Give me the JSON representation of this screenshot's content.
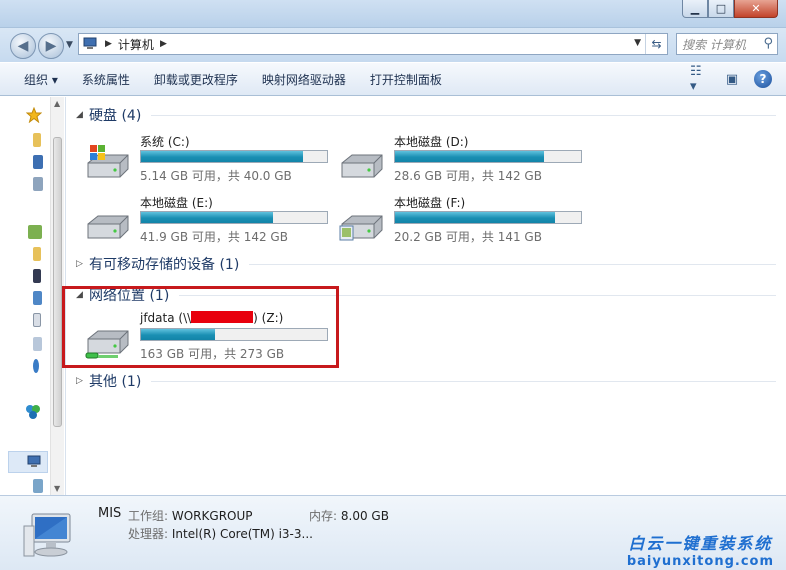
{
  "window": {
    "controls": {
      "minimize": "▁",
      "maximize": "□",
      "close": "✕"
    }
  },
  "address_bar": {
    "crumbs": [
      "计算机"
    ],
    "search_placeholder": "搜索 计算机"
  },
  "toolbar": {
    "organize": "组织 ▾",
    "system_properties": "系统属性",
    "uninstall": "卸载或更改程序",
    "map_drive": "映射网络驱动器",
    "control_panel": "打开控制面板"
  },
  "groups": {
    "hard_disks": "硬盘 (4)",
    "removable": "有可移动存储的设备 (1)",
    "network": "网络位置 (1)",
    "other": "其他 (1)"
  },
  "drives": [
    {
      "name": "系统 (C:)",
      "free": "5.14 GB 可用，共 40.0 GB",
      "used_fraction": 0.87
    },
    {
      "name": "本地磁盘 (D:)",
      "free": "28.6 GB 可用，共 142 GB",
      "used_fraction": 0.8
    },
    {
      "name": "本地磁盘 (E:)",
      "free": "41.9 GB 可用，共 142 GB",
      "used_fraction": 0.71
    },
    {
      "name": "本地磁盘 (F:)",
      "free": "20.2 GB 可用，共 141 GB",
      "used_fraction": 0.86
    }
  ],
  "network_drive": {
    "name_prefix": "jfdata (\\\\",
    "name_suffix": ") (Z:)",
    "free": "163 GB 可用，共 273 GB",
    "used_fraction": 0.4
  },
  "details": {
    "computer_name": "MIS",
    "workgroup_label": "工作组:",
    "workgroup_value": "WORKGROUP",
    "memory_label": "内存:",
    "memory_value": "8.00 GB",
    "cpu_label": "处理器:",
    "cpu_value": "Intel(R) Core(TM) i3-3..."
  },
  "watermark": {
    "cn": "白云一键重装系统",
    "en": "baiyunxitong.com"
  },
  "colors": {
    "bar_fill": "#1a8fb3",
    "highlight": "#c7191c",
    "redaction": "#e8000d"
  }
}
